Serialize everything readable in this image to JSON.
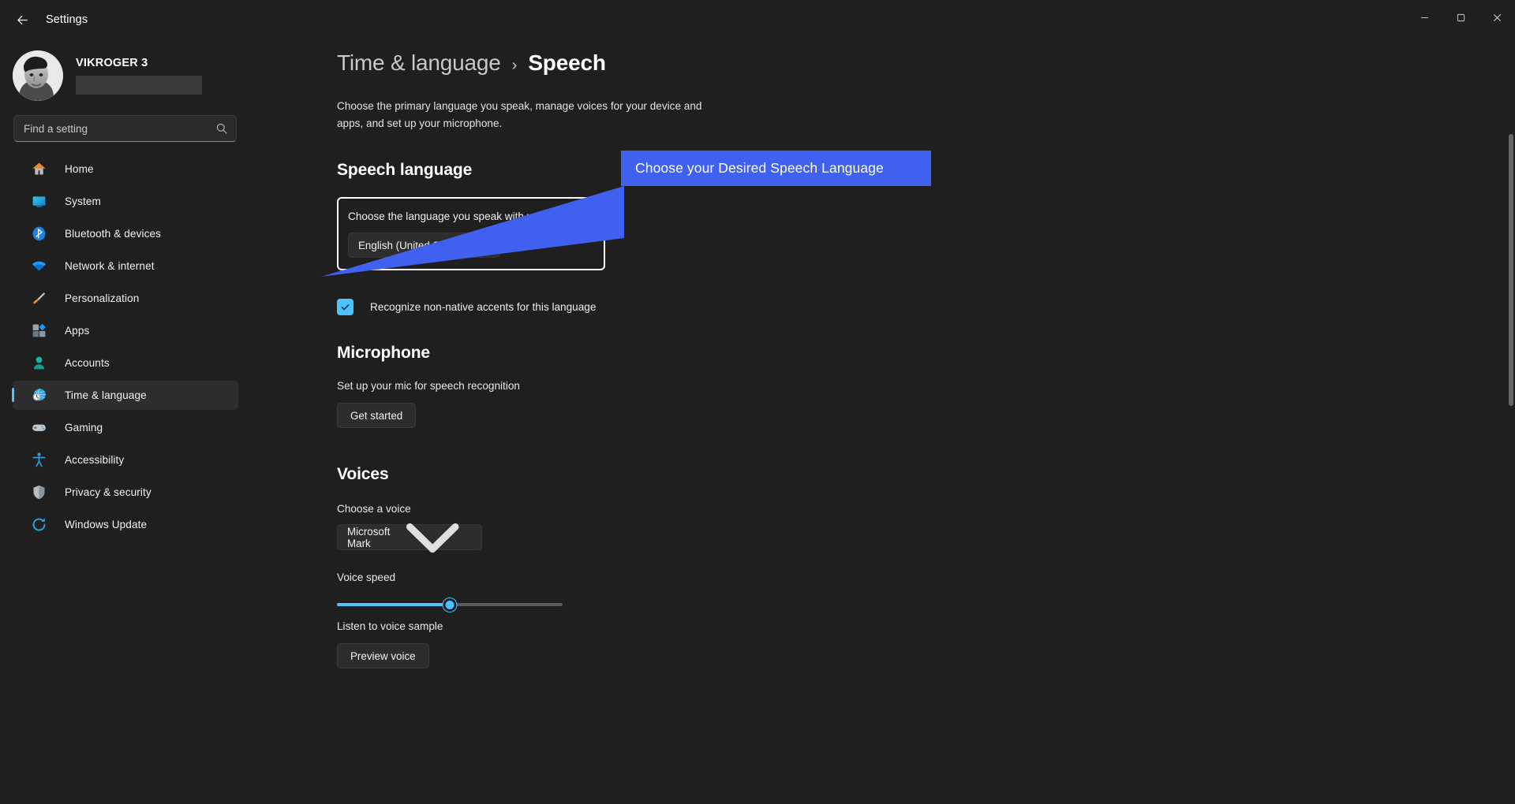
{
  "window": {
    "title": "Settings",
    "back_icon": "back-arrow-icon",
    "minimize_label": "Minimize",
    "maximize_label": "Restore",
    "close_label": "Close"
  },
  "account": {
    "name": "VIKROGER 3",
    "email_redacted": ""
  },
  "search": {
    "placeholder": "Find a setting",
    "value": "",
    "icon": "search-icon"
  },
  "sidebar": {
    "items": [
      {
        "label": "Home",
        "icon": "home-icon",
        "active": false
      },
      {
        "label": "System",
        "icon": "system-icon",
        "active": false
      },
      {
        "label": "Bluetooth & devices",
        "icon": "bluetooth-icon",
        "active": false
      },
      {
        "label": "Network & internet",
        "icon": "network-icon",
        "active": false
      },
      {
        "label": "Personalization",
        "icon": "paintbrush-icon",
        "active": false
      },
      {
        "label": "Apps",
        "icon": "apps-icon",
        "active": false
      },
      {
        "label": "Accounts",
        "icon": "accounts-icon",
        "active": false
      },
      {
        "label": "Time & language",
        "icon": "globe-clock-icon",
        "active": true
      },
      {
        "label": "Gaming",
        "icon": "gamepad-icon",
        "active": false
      },
      {
        "label": "Accessibility",
        "icon": "accessibility-icon",
        "active": false
      },
      {
        "label": "Privacy & security",
        "icon": "shield-icon",
        "active": false
      },
      {
        "label": "Windows Update",
        "icon": "update-icon",
        "active": false
      }
    ]
  },
  "main": {
    "breadcrumb_parent": "Time & language",
    "breadcrumb_separator": "›",
    "breadcrumb_current": "Speech",
    "description": "Choose the primary language you speak, manage voices for your device and apps, and set up your microphone.",
    "speech_language": {
      "heading": "Speech language",
      "field_label": "Choose the language you speak with your device",
      "selected_value": "English (United States)",
      "checkbox_label": "Recognize non-native accents for this language",
      "checkbox_checked": true
    },
    "microphone": {
      "heading": "Microphone",
      "sub_label": "Set up your mic for speech recognition",
      "button_label": "Get started"
    },
    "voices": {
      "heading": "Voices",
      "choose_label": "Choose a voice",
      "selected_voice": "Microsoft Mark",
      "speed_label": "Voice speed",
      "speed_percent": 50,
      "sample_label": "Listen to voice sample",
      "preview_button_label": "Preview voice"
    }
  },
  "callout": {
    "text": "Choose your Desired Speech Language",
    "color": "#4060f0"
  },
  "colors": {
    "accent": "#4cc2ff",
    "background": "#1f1f1f",
    "surface": "#2d2d2d",
    "callout": "#4060f0"
  }
}
